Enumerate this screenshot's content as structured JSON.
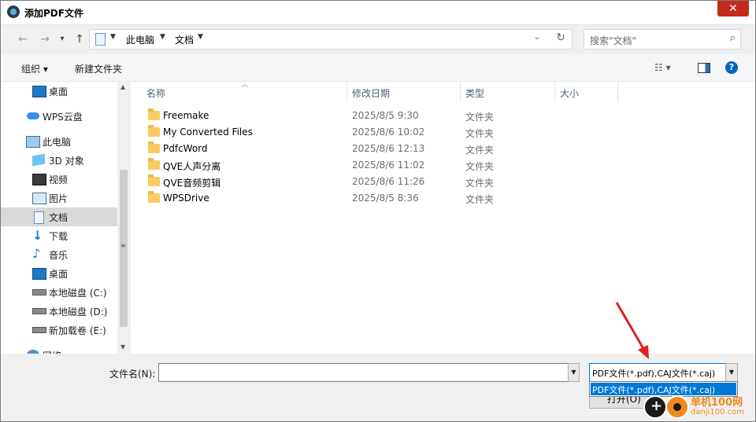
{
  "window": {
    "title": "添加PDF文件",
    "close_glyph": "✕"
  },
  "nav": {
    "back_glyph": "←",
    "forward_glyph": "→",
    "recent_glyph": "▾",
    "up_glyph": "↑",
    "breadcrumb": [
      "此电脑",
      "文档"
    ],
    "search_placeholder": "搜索\"文档\""
  },
  "toolbar": {
    "organize": "组织 ▾",
    "new_folder": "新建文件夹",
    "help": "?"
  },
  "sidebar": {
    "items": [
      {
        "label": "桌面",
        "icon": "desktop-icon"
      },
      {
        "label": "WPS云盘",
        "icon": "cloud-icon"
      },
      {
        "label": "此电脑",
        "icon": "computer-icon"
      },
      {
        "label": "3D 对象",
        "icon": "3d-objects-icon"
      },
      {
        "label": "视频",
        "icon": "video-icon"
      },
      {
        "label": "图片",
        "icon": "pictures-icon"
      },
      {
        "label": "文档",
        "icon": "documents-icon",
        "selected": true
      },
      {
        "label": "下载",
        "icon": "download-icon"
      },
      {
        "label": "音乐",
        "icon": "music-icon"
      },
      {
        "label": "桌面",
        "icon": "desktop-icon"
      },
      {
        "label": "本地磁盘 (C:)",
        "icon": "drive-icon"
      },
      {
        "label": "本地磁盘 (D:)",
        "icon": "drive-icon"
      },
      {
        "label": "新加载卷 (E:)",
        "icon": "drive-icon"
      },
      {
        "label": "网络",
        "icon": "network-icon"
      }
    ]
  },
  "columns": {
    "name": "名称",
    "date": "修改日期",
    "type": "类型",
    "size": "大小"
  },
  "files": [
    {
      "name": "Freemake",
      "date": "2025/8/5 9:30",
      "type": "文件夹"
    },
    {
      "name": "My Converted Files",
      "date": "2025/8/6 10:02",
      "type": "文件夹"
    },
    {
      "name": "PdfcWord",
      "date": "2025/8/6 12:13",
      "type": "文件夹"
    },
    {
      "name": "QVE人声分离",
      "date": "2025/8/6 11:02",
      "type": "文件夹"
    },
    {
      "name": "QVE音频剪辑",
      "date": "2025/8/6 11:26",
      "type": "文件夹"
    },
    {
      "name": "WPSDrive",
      "date": "2025/8/5 8:36",
      "type": "文件夹"
    }
  ],
  "bottom": {
    "filename_label": "文件名(N):",
    "filename_value": "",
    "filetype_selected": "PDF文件(*.pdf),CAJ文件(*.caj)",
    "filetype_options": [
      "PDF文件(*.pdf),CAJ文件(*.caj)"
    ],
    "open_label": "打开(O)"
  },
  "watermark": {
    "line1": "单机100网",
    "line2": "danji100.com"
  },
  "colors": {
    "accent": "#0078d7",
    "arrow": "#e02020",
    "folder": "#f5cd62"
  }
}
